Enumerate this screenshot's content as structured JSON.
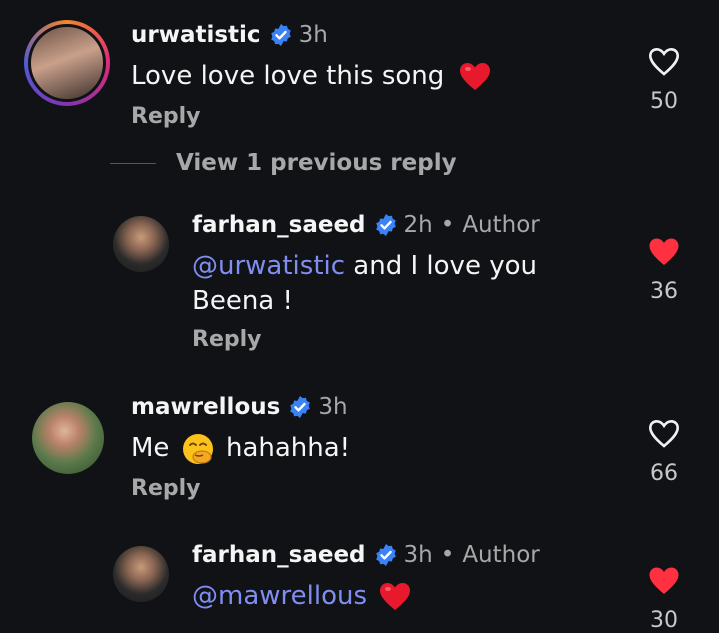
{
  "comments": [
    {
      "username": "urwatistic",
      "time": "3h",
      "text": "Love love love this song",
      "reply_label": "Reply",
      "likes": "50",
      "liked": false
    },
    {
      "username": "farhan_saeed",
      "time": "2h",
      "author_label": "Author",
      "mention": "@urwatistic",
      "text_line1": " and I love you",
      "text_line2": "Beena !",
      "reply_label": "Reply",
      "likes": "36",
      "liked": true
    },
    {
      "username": "mawrellous",
      "time": "3h",
      "text_before": "Me",
      "text_after": "hahahha!",
      "reply_label": "Reply",
      "likes": "66",
      "liked": false
    },
    {
      "username": "farhan_saeed",
      "time": "3h",
      "author_label": "Author",
      "mention": "@mawrellous",
      "likes": "30",
      "liked": true
    }
  ],
  "view_replies_label": "View 1 previous reply",
  "colors": {
    "background": "#101216",
    "mention": "#7f8ef0",
    "verified": "#3b82f6",
    "liked_heart": "#ff3040",
    "secondary_text": "#a8a8a8"
  },
  "icons": [
    "verified-badge-icon",
    "heart-outline-icon",
    "heart-filled-icon",
    "red-heart-emoji-icon",
    "giggle-emoji-icon"
  ]
}
